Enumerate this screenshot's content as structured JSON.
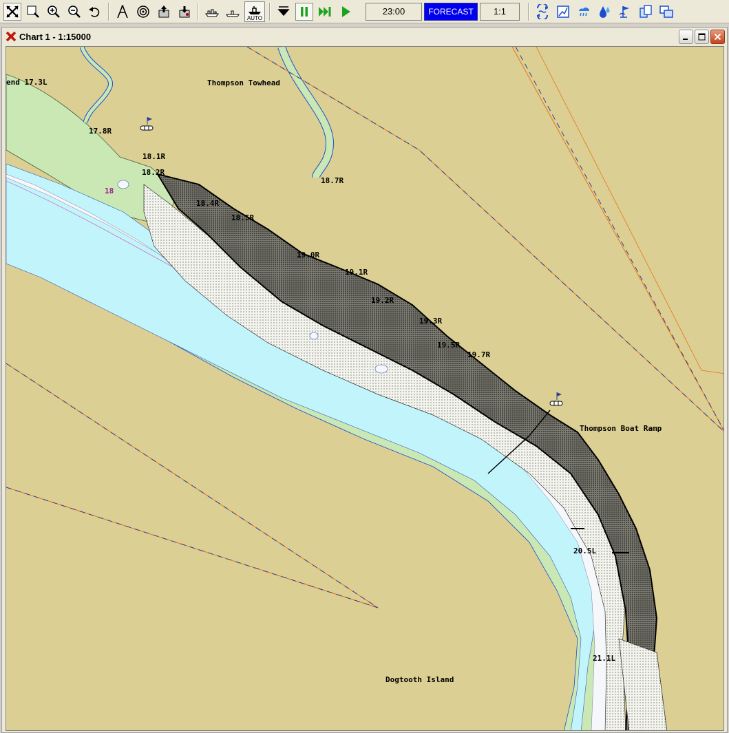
{
  "toolbar": {
    "time": "23:00",
    "forecast_label": "FORECAST",
    "scale_ratio": "1:1",
    "auto_label": "AUTO",
    "icons": [
      "select-all-icon",
      "zoom-window-icon",
      "zoom-in-icon",
      "zoom-out-icon",
      "undo-icon",
      "compass-divider-icon",
      "target-icon",
      "export-icon",
      "import-icon",
      "ship-icon",
      "boat-profile-icon",
      "auto-ship-icon",
      "goto-start-icon",
      "pause-icon",
      "fast-forward-icon",
      "play-icon",
      "tide-icon",
      "chart-view-icon",
      "weather-icon",
      "water-icon",
      "flag-icon",
      "copy-icon",
      "windows-icon"
    ]
  },
  "window": {
    "title": "Chart 1 - 1:15000"
  },
  "chart": {
    "colors": {
      "land": "#dccf93",
      "shallow_water": "#c2f5fb",
      "deep_water": "#f5f7fa",
      "wetland": "#c9e8b4",
      "route_line": "#e8741a",
      "boundary": "#2c3f9a"
    },
    "labels": {
      "bend": "end 17.3L",
      "thompson_towhead": "Thompson Towhead",
      "m17_8": "17.8R",
      "m18_1": "18.1R",
      "m18_2": "18.2R",
      "m18_4": "18.4R",
      "m18_5": "18.5R",
      "m18_7": "18.7R",
      "m19_0": "19.0R",
      "m19_1": "19.1R",
      "m19_2": "19.2R",
      "m19_3": "19.3R",
      "m19_5": "19.5R",
      "m19_7": "19.7R",
      "depth18": "18",
      "thompson_boat_ramp": "Thompson Boat Ramp",
      "m20_5": "20.5L",
      "m21_1": "21.1L",
      "dogtooth_island": "Dogtooth Island"
    }
  }
}
